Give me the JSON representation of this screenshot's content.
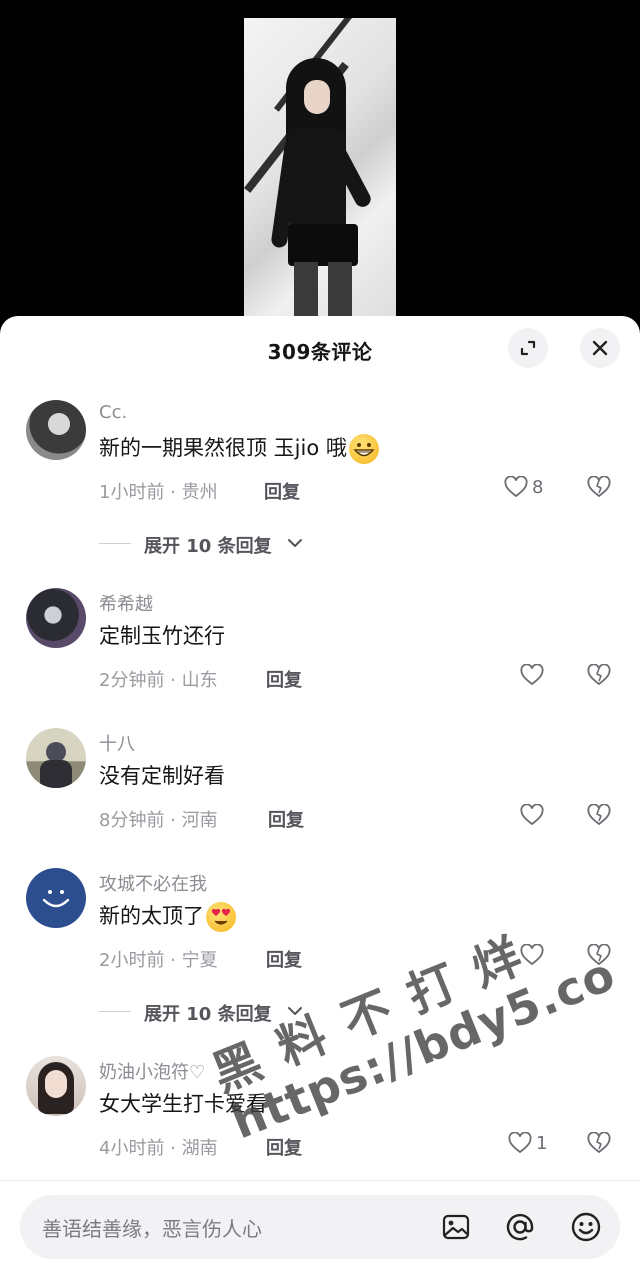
{
  "header": {
    "title": "309条评论"
  },
  "comments": [
    {
      "name": "Cc.",
      "text": "新的一期果然很顶 玉jio 哦",
      "emoji": "grin",
      "meta": "1小时前 · 贵州",
      "reply_label": "回复",
      "likes": "8",
      "avatar_color": "#5a5a5a"
    },
    {
      "name": "希希越",
      "text": "定制玉竹还行",
      "meta": "2分钟前 · 山东",
      "reply_label": "回复",
      "likes": "",
      "avatar_color": "#2b2b33"
    },
    {
      "name": "十八",
      "text": "没有定制好看",
      "meta": "8分钟前 · 河南",
      "reply_label": "回复",
      "likes": "",
      "avatar_color": "#bdb8a4"
    },
    {
      "name": "攻城不必在我",
      "text": "新的太顶了",
      "emoji": "heart-eyes",
      "meta": "2小时前 · 宁夏",
      "reply_label": "回复",
      "likes": "",
      "avatar_color": "#2c4e8f"
    },
    {
      "name": "奶油小泡符♡",
      "text": "女大学生打卡爱看",
      "meta": "4小时前 · 湖南",
      "reply_label": "回复",
      "likes": "1",
      "avatar_color": "#d9c8c0"
    }
  ],
  "expand_replies": [
    {
      "label": "展开 10 条回复"
    },
    {
      "label": "展开 10 条回复"
    }
  ],
  "input": {
    "placeholder": "善语结善缘，恶言伤人心"
  },
  "watermark": {
    "line1": "黑料不打烊",
    "line2": "https://bdy5.co"
  },
  "colors": {
    "sheet_bg": "#ffffff",
    "text_primary": "#161616",
    "text_secondary": "#8c8c93"
  }
}
